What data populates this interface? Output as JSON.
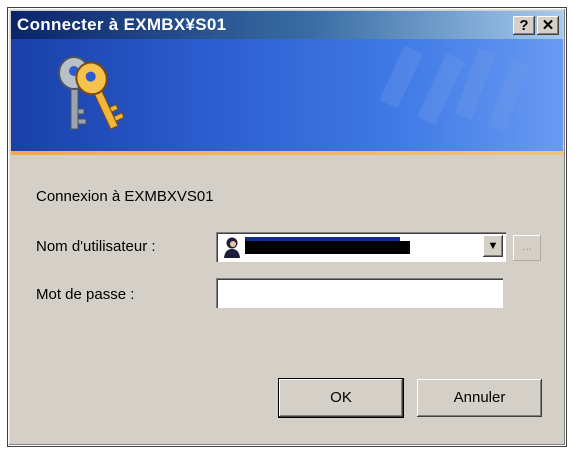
{
  "window": {
    "title": "Connecter à EXMBX¥S01",
    "help_label": "?",
    "close_label": "✕"
  },
  "form": {
    "connection_text": "Connexion à EXMBXVS01",
    "username_label": "Nom d'utilisateur :",
    "username_value": "",
    "password_label": "Mot de passe :",
    "password_value": "",
    "browse_label": "...",
    "combo_arrow": "▼"
  },
  "buttons": {
    "ok_label": "OK",
    "cancel_label": "Annuler"
  },
  "icons": [
    "keys-icon",
    "user-icon",
    "dropdown-arrow-icon"
  ],
  "colors": {
    "titlebar_start": "#0a246a",
    "banner": "#2c5ccf",
    "banner_accent": "#f6a84a",
    "dialog_bg": "#d4d0c8"
  }
}
